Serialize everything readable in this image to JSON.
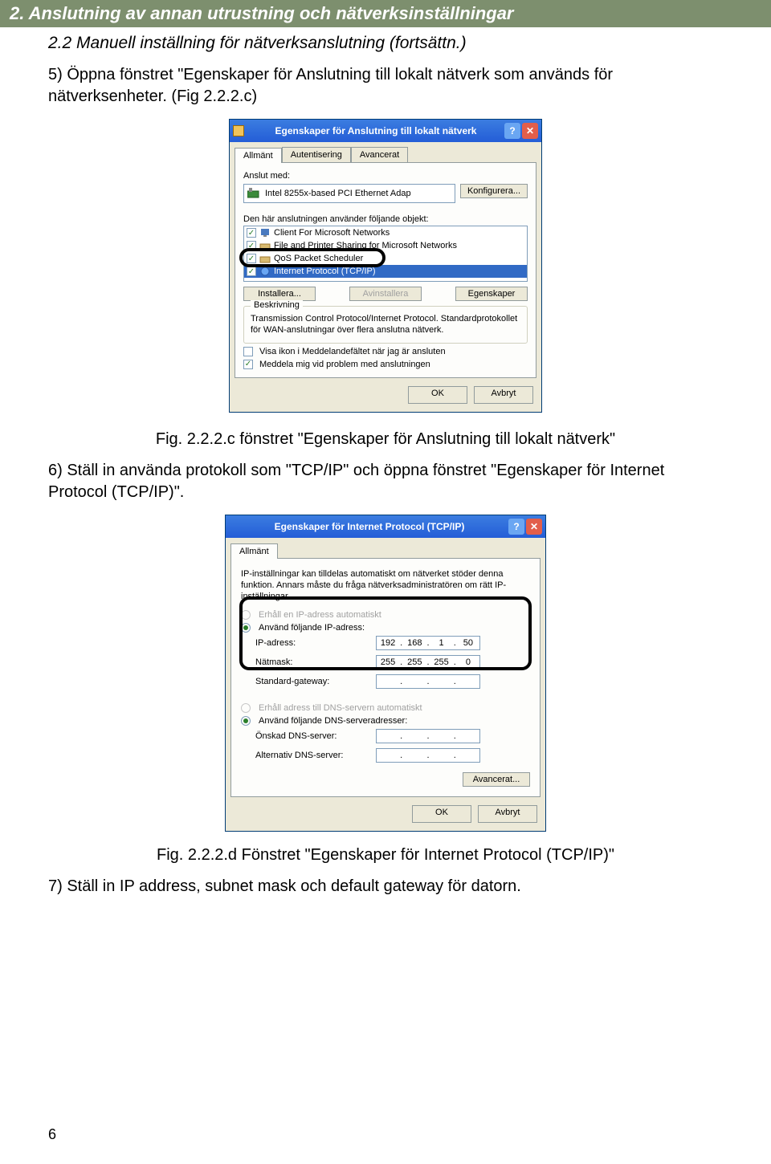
{
  "header": "2. Anslutning av annan utrustning och nätverksinställningar",
  "subheading": "2.2 Manuell inställning för nätverksanslutning (fortsättn.)",
  "step5": "5) Öppna fönstret \"Egenskaper för Anslutning till lokalt nätverk som används för nätverksenheter. (Fig 2.2.2.c)",
  "caption1": "Fig. 2.2.2.c fönstret \"Egenskaper för Anslutning till lokalt nätverk\"",
  "step6": "6) Ställ in använda protokoll som \"TCP/IP\" och öppna fönstret \"Egenskaper för Internet Protocol (TCP/IP)\".",
  "caption2": "Fig. 2.2.2.d Fönstret \"Egenskaper för Internet Protocol (TCP/IP)\"",
  "step7": "7) Ställ in IP address, subnet mask och default gateway för datorn.",
  "pageNumber": "6",
  "dlg1": {
    "title": "Egenskaper för Anslutning till lokalt nätverk",
    "tabs": [
      "Allmänt",
      "Autentisering",
      "Avancerat"
    ],
    "connectWith": "Anslut med:",
    "adapter": "Intel 8255x-based PCI Ethernet Adap",
    "configure": "Konfigurera...",
    "usesLabel": "Den här anslutningen använder följande objekt:",
    "items": [
      "Client For Microsoft Networks",
      "File and Printer Sharing for Microsoft Networks",
      "QoS Packet Scheduler",
      "Internet Protocol (TCP/IP)"
    ],
    "install": "Installera...",
    "uninstall": "Avinstallera",
    "properties": "Egenskaper",
    "descTitle": "Beskrivning",
    "desc": "Transmission Control Protocol/Internet Protocol. Standardprotokollet för WAN-anslutningar över flera anslutna nätverk.",
    "showIcon": "Visa ikon i Meddelandefältet när jag är ansluten",
    "notify": "Meddela mig vid problem med anslutningen",
    "ok": "OK",
    "cancel": "Avbryt"
  },
  "dlg2": {
    "title": "Egenskaper för Internet Protocol (TCP/IP)",
    "tab": "Allmänt",
    "intro": "IP-inställningar kan tilldelas automatiskt om nätverket stöder denna funktion. Annars måste du fråga nätverksadministratören om rätt IP-inställningar.",
    "r1": "Erhåll en IP-adress automatiskt",
    "r2": "Använd följande IP-adress:",
    "ipLabel": "IP-adress:",
    "ip": [
      "192",
      "168",
      "1",
      "50"
    ],
    "maskLabel": "Nätmask:",
    "mask": [
      "255",
      "255",
      "255",
      "0"
    ],
    "gwLabel": "Standard-gateway:",
    "r3": "Erhåll adress till DNS-servern automatiskt",
    "r4": "Använd följande DNS-serveradresser:",
    "dns1Label": "Önskad DNS-server:",
    "dns2Label": "Alternativ DNS-server:",
    "advanced": "Avancerat...",
    "ok": "OK",
    "cancel": "Avbryt"
  }
}
